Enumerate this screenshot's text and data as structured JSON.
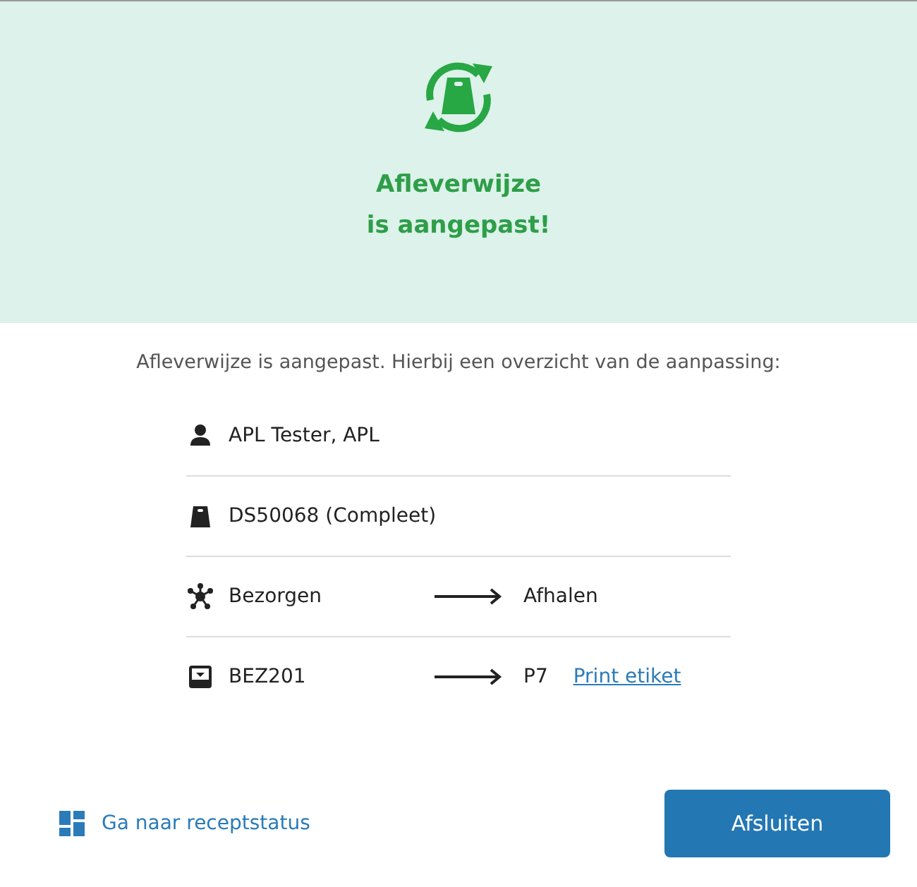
{
  "header": {
    "title_lines": [
      "Afleverwijze",
      "is aangepast!"
    ]
  },
  "intro": "Afleverwijze is aangepast. Hierbij een overzicht van de aanpassing:",
  "rows": [
    {
      "kind": "person",
      "text": "APL Tester, APL"
    },
    {
      "kind": "bag",
      "text": "DS50068 (Compleet)"
    },
    {
      "kind": "network",
      "text": "Bezorgen",
      "to": "Afhalen"
    },
    {
      "kind": "inbox",
      "text": "BEZ201",
      "to": "P7",
      "link": "Print etiket"
    }
  ],
  "footer": {
    "link": "Ga naar receptstatus",
    "button": "Afsluiten"
  }
}
